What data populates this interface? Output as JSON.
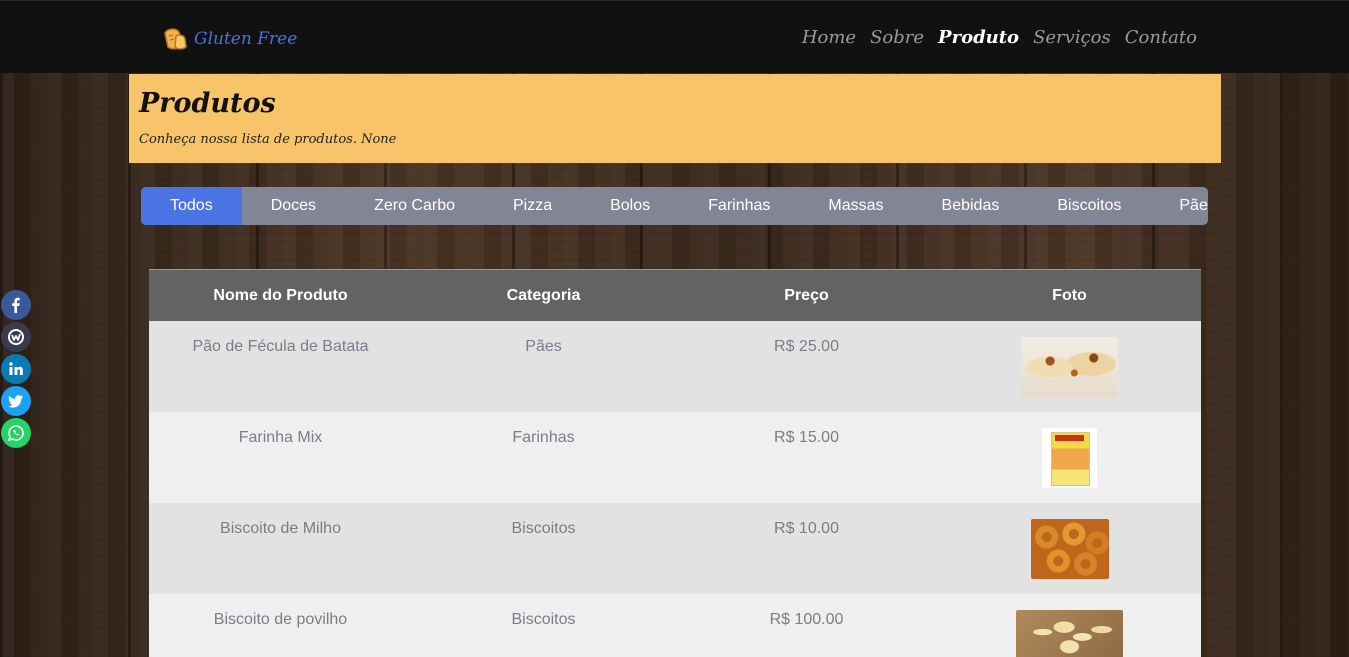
{
  "nav": {
    "brand": "Gluten Free",
    "links": [
      {
        "label": "Home",
        "active": false
      },
      {
        "label": "Sobre",
        "active": false
      },
      {
        "label": "Produto",
        "active": true
      },
      {
        "label": "Serviços",
        "active": false
      },
      {
        "label": "Contato",
        "active": false
      }
    ]
  },
  "header": {
    "title": "Produtos",
    "subtitle": "Conheça nossa lista de produtos. None"
  },
  "tabs": [
    {
      "label": "Todos",
      "active": true
    },
    {
      "label": "Doces",
      "active": false
    },
    {
      "label": "Zero Carbo",
      "active": false
    },
    {
      "label": "Pizza",
      "active": false
    },
    {
      "label": "Bolos",
      "active": false
    },
    {
      "label": "Farinhas",
      "active": false
    },
    {
      "label": "Massas",
      "active": false
    },
    {
      "label": "Bebidas",
      "active": false
    },
    {
      "label": "Biscoitos",
      "active": false
    },
    {
      "label": "Pães",
      "active": false
    }
  ],
  "table": {
    "headers": [
      "Nome do Produto",
      "Categoria",
      "Preço",
      "Foto"
    ],
    "rows": [
      {
        "name": "Pão de Fécula de Batata",
        "category": "Pães",
        "price": "R$ 25.00",
        "photo": "bread-photo"
      },
      {
        "name": "Farinha Mix",
        "category": "Farinhas",
        "price": "R$ 15.00",
        "photo": "flour-package-photo"
      },
      {
        "name": "Biscoito de Milho",
        "category": "Biscoitos",
        "price": "R$ 10.00",
        "photo": "corn-biscuit-photo"
      },
      {
        "name": "Biscoito de povilho",
        "category": "Biscoitos",
        "price": "R$ 100.00",
        "photo": "povilho-biscuit-photo"
      }
    ]
  },
  "social": [
    {
      "name": "facebook-icon"
    },
    {
      "name": "workplace-icon"
    },
    {
      "name": "linkedin-icon"
    },
    {
      "name": "twitter-icon"
    },
    {
      "name": "whatsapp-icon"
    }
  ],
  "colors": {
    "navbar": "#111111",
    "brand": "#4f6fe0",
    "header_band": "#f8c46a",
    "tab_bar": "#828594",
    "tab_active": "#4a74e3",
    "table_header": "#636363"
  }
}
